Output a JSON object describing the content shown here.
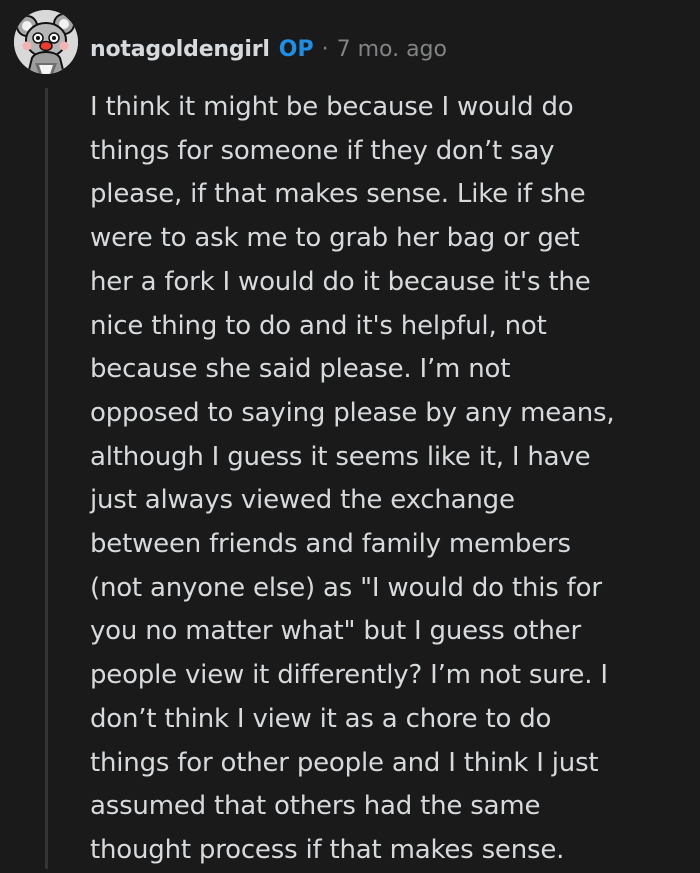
{
  "comment": {
    "author": "notagoldengirl",
    "op_badge": "OP",
    "separator": "·",
    "timestamp": "7 mo. ago",
    "avatar_icon": "koala-snoo-avatar-icon",
    "body_lines": [
      "I think it might be because I would do",
      "things for someone if they don’t say",
      "please, if that makes sense. Like if she",
      "were to ask me to grab her bag or get",
      "her a fork I would do it because it's the",
      "nice thing to do and it's helpful, not",
      "because she said please. I’m not",
      "opposed to saying please by any means,",
      "although I guess it seems like it, I have",
      "just always viewed the exchange",
      "between friends and family members",
      "(not anyone else) as \"I would do this for",
      "you no matter what\" but I guess other",
      "people view it differently? I’m not sure. I",
      "don’t think I view it as a chore to do",
      "things for other people and I think I just",
      "assumed that others had the same",
      "thought process if that makes sense."
    ]
  },
  "colors": {
    "background": "#1a1a1b",
    "text": "#d7dadc",
    "op_badge": "#1f8fe6",
    "muted": "#818384",
    "thread_line": "#343536"
  }
}
